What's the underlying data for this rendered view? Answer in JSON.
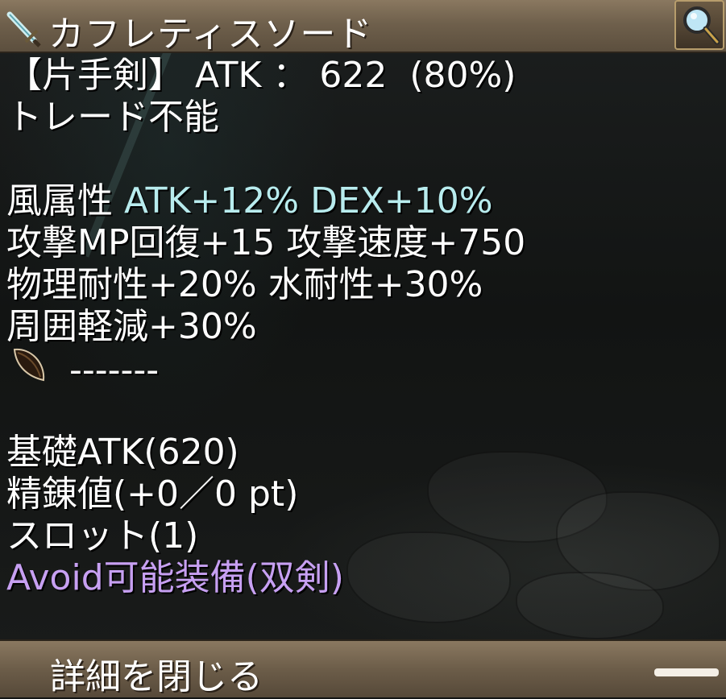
{
  "item": {
    "name": "カフレティスソード",
    "lines": [
      {
        "id": "header",
        "text": "【片手剣】 ATK ： 622  (80%)"
      },
      {
        "id": "trade",
        "text": "トレード不能"
      },
      {
        "id": "element_label",
        "text": "風属性 "
      },
      {
        "id": "element_bonus",
        "text": "ATK+12% DEX+10%"
      },
      {
        "id": "stat1",
        "text": "攻撃MP回復+15 攻撃速度+750"
      },
      {
        "id": "stat2",
        "text": "物理耐性+20% 水耐性+30%"
      },
      {
        "id": "stat3",
        "text": "周囲軽減+30%"
      },
      {
        "id": "slot_line",
        "text": "-------"
      },
      {
        "id": "base_atk",
        "text": "基礎ATK(620)"
      },
      {
        "id": "refine",
        "text": "精錬値(+0／0 pt)"
      },
      {
        "id": "slots",
        "text": "スロット(1)"
      },
      {
        "id": "avoid",
        "text": "Avoid可能装備(双剣)"
      }
    ]
  },
  "footer": {
    "close_label": "詳細を閉じる"
  },
  "icons": {
    "weapon": "sword-icon",
    "search": "magnifier-icon",
    "slot": "leaf-icon"
  },
  "colors": {
    "cyan_text": "#b8ecee",
    "purple_text": "#c7a0f2",
    "bar_brown": "#6f604c"
  }
}
